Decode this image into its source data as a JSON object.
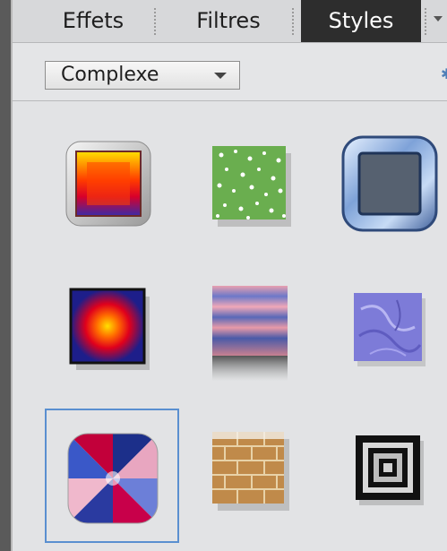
{
  "tabs": [
    {
      "label": "Effets",
      "active": false
    },
    {
      "label": "Filtres",
      "active": false
    },
    {
      "label": "Styles",
      "active": true
    }
  ],
  "category_dropdown": {
    "selected": "Complexe"
  },
  "accent_color": "#5a8fd0",
  "styles_grid": {
    "selected_index": 6,
    "items": [
      {
        "icon": "orange-bevel-frame-style"
      },
      {
        "icon": "green-speckle-style"
      },
      {
        "icon": "blue-chrome-frame-style"
      },
      {
        "icon": "red-radial-glow-style"
      },
      {
        "icon": "pink-blue-stripes-style"
      },
      {
        "icon": "purple-texture-style"
      },
      {
        "icon": "pinwheel-gradient-style"
      },
      {
        "icon": "brick-texture-style"
      },
      {
        "icon": "concentric-squares-style"
      }
    ]
  }
}
